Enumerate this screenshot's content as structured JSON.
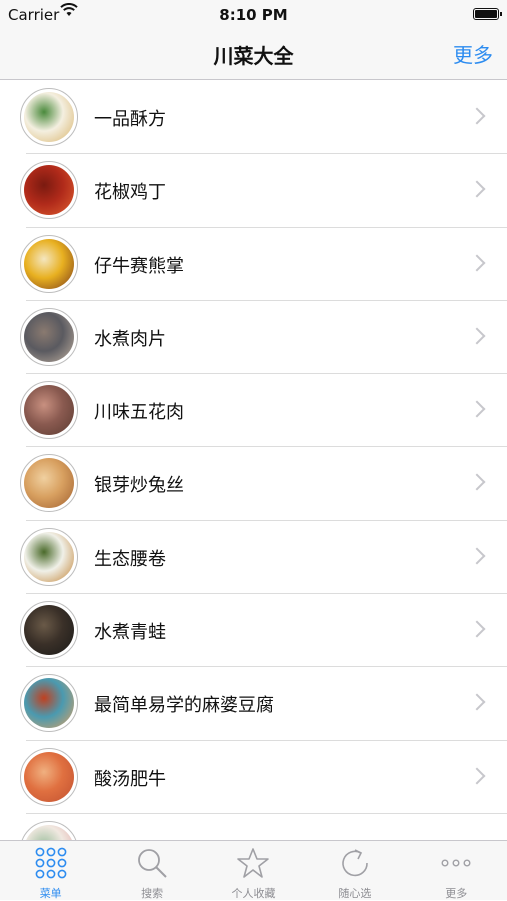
{
  "status": {
    "carrier": "Carrier",
    "time": "8:10 PM"
  },
  "nav": {
    "title": "川菜大全",
    "more": "更多"
  },
  "dishes": [
    {
      "name": "一品酥方",
      "colors": [
        "#f4efe0",
        "#4a8a3c",
        "#d8b36a"
      ]
    },
    {
      "name": "花椒鸡丁",
      "colors": [
        "#b02a1a",
        "#7a1a10",
        "#e06030"
      ]
    },
    {
      "name": "仔牛赛熊掌",
      "colors": [
        "#e8b020",
        "#f4e6c0",
        "#7a3a1a"
      ]
    },
    {
      "name": "水煮肉片",
      "colors": [
        "#5a5a60",
        "#8a7a70",
        "#c0b0a0"
      ]
    },
    {
      "name": "川味五花肉",
      "colors": [
        "#8a5a50",
        "#c89080",
        "#5a3a30"
      ]
    },
    {
      "name": "银芽炒兔丝",
      "colors": [
        "#d8a060",
        "#f0d0a0",
        "#a06030"
      ]
    },
    {
      "name": "生态腰卷",
      "colors": [
        "#f0f0e8",
        "#4a6a2a",
        "#c08030"
      ]
    },
    {
      "name": "水煮青蛙",
      "colors": [
        "#3a3028",
        "#6a5a48",
        "#1a1a18"
      ]
    },
    {
      "name": "最简单易学的麻婆豆腐",
      "colors": [
        "#4a9ab0",
        "#c04020",
        "#e0a060"
      ]
    },
    {
      "name": "酸汤肥牛",
      "colors": [
        "#e07040",
        "#f0b080",
        "#c05030"
      ]
    },
    {
      "name": "",
      "colors": [
        "#f0e8e0",
        "#a0c0a0",
        "#e0a0a0"
      ]
    }
  ],
  "tabs": [
    {
      "label": "菜单",
      "icon": "grid-icon",
      "active": true
    },
    {
      "label": "搜索",
      "icon": "search-icon",
      "active": false
    },
    {
      "label": "个人收藏",
      "icon": "star-icon",
      "active": false
    },
    {
      "label": "随心选",
      "icon": "refresh-icon",
      "active": false
    },
    {
      "label": "更多",
      "icon": "more-icon",
      "active": false
    }
  ],
  "colors": {
    "accent": "#2d8cf0",
    "inactive": "#8e8e93"
  }
}
